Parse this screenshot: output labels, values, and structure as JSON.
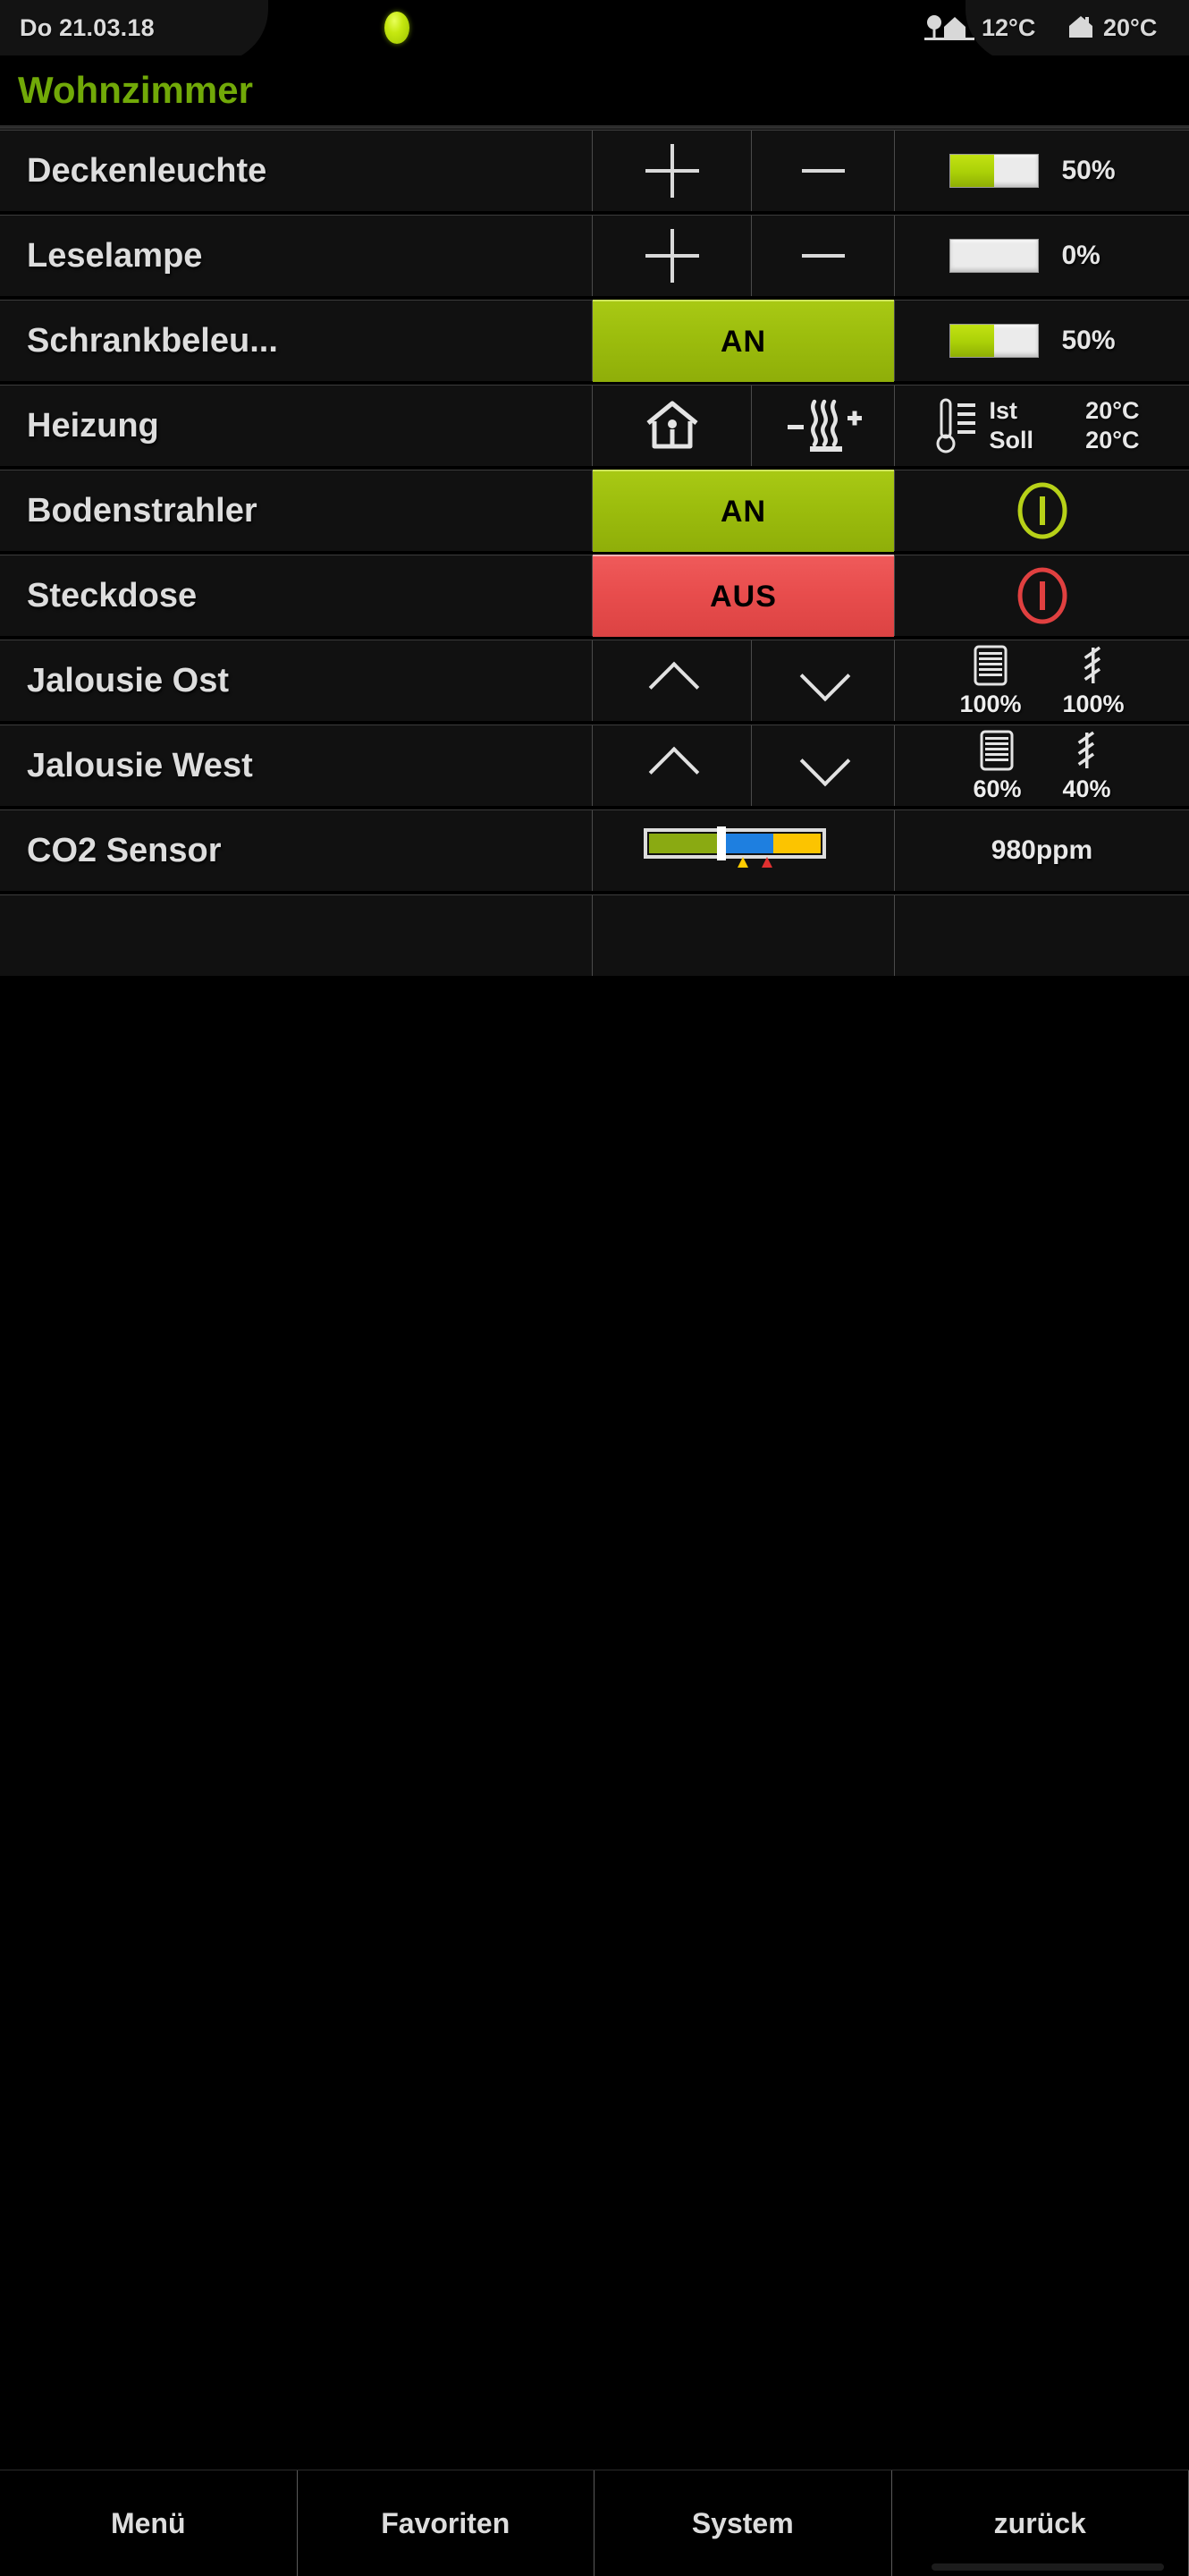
{
  "statusbar": {
    "date": "Do 21.03.18",
    "led": {
      "name": "status-led",
      "color": "#c6e810"
    },
    "outdoor": {
      "icon": "tree-house-icon",
      "temperature": "12°C"
    },
    "indoor": {
      "icon": "house-icon",
      "temperature": "20°C"
    }
  },
  "header": {
    "title": "Wohnzimmer",
    "title_color": "#71a908"
  },
  "colors": {
    "on": "#9cbd0d",
    "off": "#e84d4d",
    "slider_fill": "#aad007",
    "co2_green": "#8aaa12",
    "co2_blue": "#1e7fe0",
    "co2_yellow": "#fcc400",
    "co2_marker_yellow": "#ffcc00",
    "co2_marker_red": "#e03030"
  },
  "rows": [
    {
      "label": "Deckenleuchte",
      "type": "dimmer",
      "plus_label": "+",
      "minus_label": "−",
      "value_pct": "50%",
      "fill": 50
    },
    {
      "label": "Leselampe",
      "type": "dimmer",
      "plus_label": "+",
      "minus_label": "−",
      "value_pct": "0%",
      "fill": 0
    },
    {
      "label": "Schrankbeleu...",
      "type": "switch-dimmer",
      "state_label": "AN",
      "state": "on",
      "value_pct": "50%",
      "fill": 50
    },
    {
      "label": "Heizung",
      "type": "heating",
      "mode_icon": "house-presence-icon",
      "adjust_icon": "heating-minus-plus-icon",
      "sensor_icon": "thermometer-icon",
      "actual_key": "Ist",
      "actual_value": "20°C",
      "target_key": "Soll",
      "target_value": "20°C"
    },
    {
      "label": "Bodenstrahler",
      "type": "switch",
      "state_label": "AN",
      "state": "on",
      "indicator_icon": "power-on-icon"
    },
    {
      "label": "Steckdose",
      "type": "switch",
      "state_label": "AUS",
      "state": "off",
      "indicator_icon": "power-off-icon"
    },
    {
      "label": "Jalousie Ost",
      "type": "blind",
      "up_icon": "chevron-up-icon",
      "down_icon": "chevron-down-icon",
      "position_icon": "blind-position-icon",
      "position_pct": "100%",
      "slat_icon": "slat-angle-icon",
      "slat_pct": "100%"
    },
    {
      "label": "Jalousie West",
      "type": "blind",
      "up_icon": "chevron-up-icon",
      "down_icon": "chevron-down-icon",
      "position_icon": "blind-position-icon",
      "position_pct": "60%",
      "slat_icon": "slat-angle-icon",
      "slat_pct": "40%"
    },
    {
      "label": "CO2 Sensor",
      "type": "sensor",
      "gauge_icon": "co2-gauge-icon",
      "value": "980ppm"
    },
    {
      "label": "",
      "type": "empty"
    }
  ],
  "bottomnav": {
    "items": [
      {
        "label": "Menü"
      },
      {
        "label": "Favoriten"
      },
      {
        "label": "System"
      },
      {
        "label": "zurück"
      }
    ]
  }
}
